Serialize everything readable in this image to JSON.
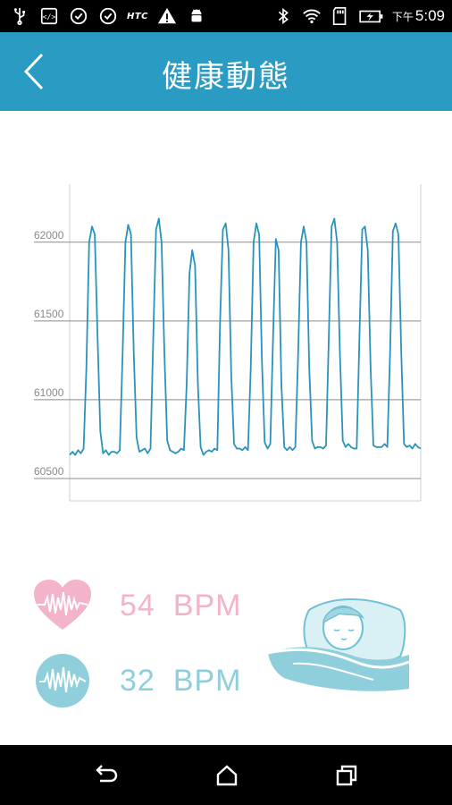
{
  "status_bar": {
    "icons_left": [
      "usb-icon",
      "debug-icon",
      "sync-icon",
      "sync-icon",
      "htc-logo",
      "warning-icon",
      "android-icon"
    ],
    "htc_label": "HTC",
    "icons_right": [
      "bluetooth-icon",
      "wifi-icon",
      "sd-card-icon",
      "battery-charging-icon"
    ],
    "time_prefix": "下午",
    "time": "5:09"
  },
  "app_bar": {
    "title": "健康動態",
    "background": "#2a9bc2"
  },
  "chart_data": {
    "type": "line",
    "title": "",
    "xlabel": "",
    "ylabel": "",
    "yticks": [
      "62000",
      "61500",
      "61000",
      "60500"
    ],
    "ytick_values": [
      62000,
      61500,
      61000,
      60500
    ],
    "ylim": [
      60500,
      62050
    ],
    "grid": true,
    "line_color": "#2a93bc",
    "series": [
      {
        "values": [
          60650,
          60670,
          60650,
          60680,
          60660,
          60690,
          61200,
          62000,
          62100,
          62050,
          61400,
          60800,
          60660,
          60680,
          60650,
          60670,
          60670,
          60660,
          60680,
          61300,
          62000,
          62110,
          62050,
          61300,
          60760,
          60670,
          60680,
          60690,
          60660,
          60690,
          61400,
          62080,
          62150,
          62000,
          61300,
          60740,
          60680,
          60670,
          60660,
          60670,
          60690,
          60680,
          61100,
          61800,
          61950,
          61850,
          61100,
          60700,
          60650,
          60670,
          60680,
          60670,
          60690,
          60680,
          61500,
          62080,
          62120,
          61950,
          61150,
          60720,
          60690,
          60690,
          60680,
          60700,
          60680,
          61200,
          62000,
          62120,
          62050,
          61250,
          60730,
          60690,
          60720,
          61400,
          62020,
          61950,
          61100,
          60700,
          60680,
          60700,
          60680,
          60700,
          61300,
          62000,
          62100,
          62000,
          61200,
          60740,
          60690,
          60700,
          60700,
          60690,
          60710,
          61400,
          62100,
          62150,
          62000,
          61300,
          60740,
          60700,
          60720,
          60700,
          60690,
          60690,
          61400,
          62080,
          62100,
          61950,
          61200,
          60710,
          60700,
          60700,
          60700,
          60720,
          60700,
          61300,
          62070,
          62120,
          62050,
          61300,
          60720,
          60700,
          60710,
          60690,
          60720,
          60700,
          60690
        ]
      }
    ]
  },
  "vitals": {
    "heart_rate": {
      "value": "54",
      "unit": "BPM",
      "color": "#f3b3cb"
    },
    "breathing_rate": {
      "value": "32",
      "unit": "BPM",
      "color": "#8fcfdc"
    }
  },
  "nav_bar": {
    "buttons": [
      "back-icon",
      "home-icon",
      "recents-icon"
    ]
  }
}
